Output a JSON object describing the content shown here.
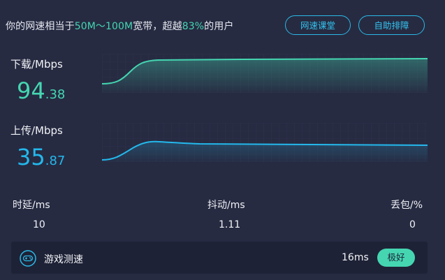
{
  "summary": {
    "prefix": "你的网速相当于",
    "bandwidth_range": "50M～100M",
    "middle": "宽带，超越",
    "percent": "83%",
    "suffix": "的用户"
  },
  "buttons": {
    "course": "网速课堂",
    "rank": "自助排障"
  },
  "download": {
    "label": "下载/Mbps",
    "value_int": "94",
    "value_dec": ".38"
  },
  "upload": {
    "label": "上传/Mbps",
    "value_int": "35",
    "value_dec": ".87"
  },
  "stats": {
    "latency_label": "时延/ms",
    "latency_value": "10",
    "jitter_label": "抖动/ms",
    "jitter_value": "1.11",
    "loss_label": "丢包/%",
    "loss_value": "0"
  },
  "game": {
    "label": "游戏测速",
    "latency": "16ms",
    "rating": "极好"
  },
  "colors": {
    "download_line": "#45d6b1",
    "upload_line": "#24b8ec",
    "background": "#262b42",
    "accent_button": "#33c2ee"
  },
  "icons": {
    "game": "gamepad-icon"
  }
}
